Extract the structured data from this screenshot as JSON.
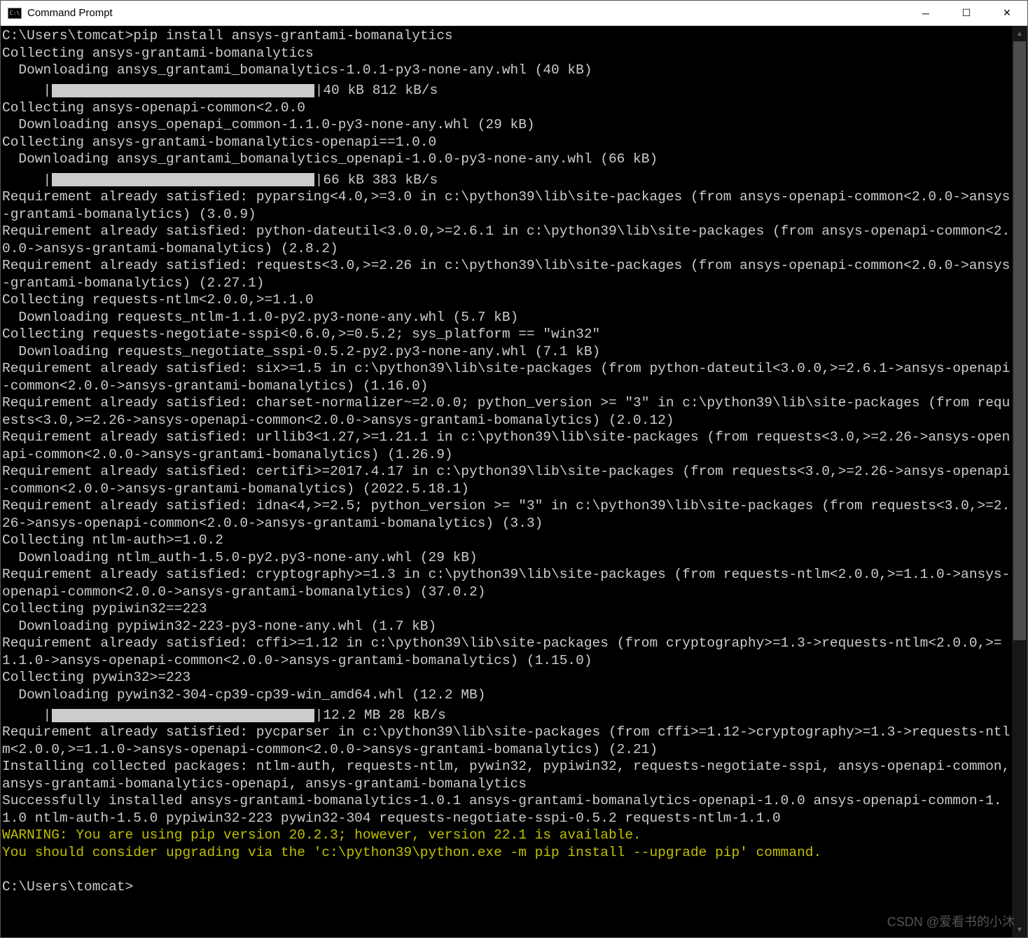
{
  "window": {
    "title": "Command Prompt",
    "icon_glyph": "C:\\"
  },
  "titlebar_buttons": {
    "minimize": "─",
    "maximize": "☐",
    "close": "✕"
  },
  "progress": {
    "p1": "40 kB 812 kB/s",
    "p2": "66 kB 383 kB/s",
    "p3": "12.2 MB 28 kB/s"
  },
  "terminal": {
    "l01": "C:\\Users\\tomcat>pip install ansys-grantami-bomanalytics",
    "l02": "Collecting ansys-grantami-bomanalytics",
    "l03": "  Downloading ansys_grantami_bomanalytics-1.0.1-py3-none-any.whl (40 kB)",
    "l04": "Collecting ansys-openapi-common<2.0.0",
    "l05": "  Downloading ansys_openapi_common-1.1.0-py3-none-any.whl (29 kB)",
    "l06": "Collecting ansys-grantami-bomanalytics-openapi==1.0.0",
    "l07": "  Downloading ansys_grantami_bomanalytics_openapi-1.0.0-py3-none-any.whl (66 kB)",
    "l08": "Requirement already satisfied: pyparsing<4.0,>=3.0 in c:\\python39\\lib\\site-packages (from ansys-openapi-common<2.0.0->ansys-grantami-bomanalytics) (3.0.9)",
    "l09": "Requirement already satisfied: python-dateutil<3.0.0,>=2.6.1 in c:\\python39\\lib\\site-packages (from ansys-openapi-common<2.0.0->ansys-grantami-bomanalytics) (2.8.2)",
    "l10": "Requirement already satisfied: requests<3.0,>=2.26 in c:\\python39\\lib\\site-packages (from ansys-openapi-common<2.0.0->ansys-grantami-bomanalytics) (2.27.1)",
    "l11": "Collecting requests-ntlm<2.0.0,>=1.1.0",
    "l12": "  Downloading requests_ntlm-1.1.0-py2.py3-none-any.whl (5.7 kB)",
    "l13": "Collecting requests-negotiate-sspi<0.6.0,>=0.5.2; sys_platform == \"win32\"",
    "l14": "  Downloading requests_negotiate_sspi-0.5.2-py2.py3-none-any.whl (7.1 kB)",
    "l15": "Requirement already satisfied: six>=1.5 in c:\\python39\\lib\\site-packages (from python-dateutil<3.0.0,>=2.6.1->ansys-openapi-common<2.0.0->ansys-grantami-bomanalytics) (1.16.0)",
    "l16": "Requirement already satisfied: charset-normalizer~=2.0.0; python_version >= \"3\" in c:\\python39\\lib\\site-packages (from requests<3.0,>=2.26->ansys-openapi-common<2.0.0->ansys-grantami-bomanalytics) (2.0.12)",
    "l17": "Requirement already satisfied: urllib3<1.27,>=1.21.1 in c:\\python39\\lib\\site-packages (from requests<3.0,>=2.26->ansys-openapi-common<2.0.0->ansys-grantami-bomanalytics) (1.26.9)",
    "l18": "Requirement already satisfied: certifi>=2017.4.17 in c:\\python39\\lib\\site-packages (from requests<3.0,>=2.26->ansys-openapi-common<2.0.0->ansys-grantami-bomanalytics) (2022.5.18.1)",
    "l19": "Requirement already satisfied: idna<4,>=2.5; python_version >= \"3\" in c:\\python39\\lib\\site-packages (from requests<3.0,>=2.26->ansys-openapi-common<2.0.0->ansys-grantami-bomanalytics) (3.3)",
    "l20": "Collecting ntlm-auth>=1.0.2",
    "l21": "  Downloading ntlm_auth-1.5.0-py2.py3-none-any.whl (29 kB)",
    "l22": "Requirement already satisfied: cryptography>=1.3 in c:\\python39\\lib\\site-packages (from requests-ntlm<2.0.0,>=1.1.0->ansys-openapi-common<2.0.0->ansys-grantami-bomanalytics) (37.0.2)",
    "l23": "Collecting pypiwin32==223",
    "l24": "  Downloading pypiwin32-223-py3-none-any.whl (1.7 kB)",
    "l25": "Requirement already satisfied: cffi>=1.12 in c:\\python39\\lib\\site-packages (from cryptography>=1.3->requests-ntlm<2.0.0,>=1.1.0->ansys-openapi-common<2.0.0->ansys-grantami-bomanalytics) (1.15.0)",
    "l26": "Collecting pywin32>=223",
    "l27": "  Downloading pywin32-304-cp39-cp39-win_amd64.whl (12.2 MB)",
    "l28": "Requirement already satisfied: pycparser in c:\\python39\\lib\\site-packages (from cffi>=1.12->cryptography>=1.3->requests-ntlm<2.0.0,>=1.1.0->ansys-openapi-common<2.0.0->ansys-grantami-bomanalytics) (2.21)",
    "l29": "Installing collected packages: ntlm-auth, requests-ntlm, pywin32, pypiwin32, requests-negotiate-sspi, ansys-openapi-common, ansys-grantami-bomanalytics-openapi, ansys-grantami-bomanalytics",
    "l30": "Successfully installed ansys-grantami-bomanalytics-1.0.1 ansys-grantami-bomanalytics-openapi-1.0.0 ansys-openapi-common-1.1.0 ntlm-auth-1.5.0 pypiwin32-223 pywin32-304 requests-negotiate-sspi-0.5.2 requests-ntlm-1.1.0",
    "l31": "WARNING: You are using pip version 20.2.3; however, version 22.1 is available.",
    "l32": "You should consider upgrading via the 'c:\\python39\\python.exe -m pip install --upgrade pip' command.",
    "l33": "",
    "l34": "C:\\Users\\tomcat>"
  },
  "watermark": "CSDN @爱看书的小沐"
}
